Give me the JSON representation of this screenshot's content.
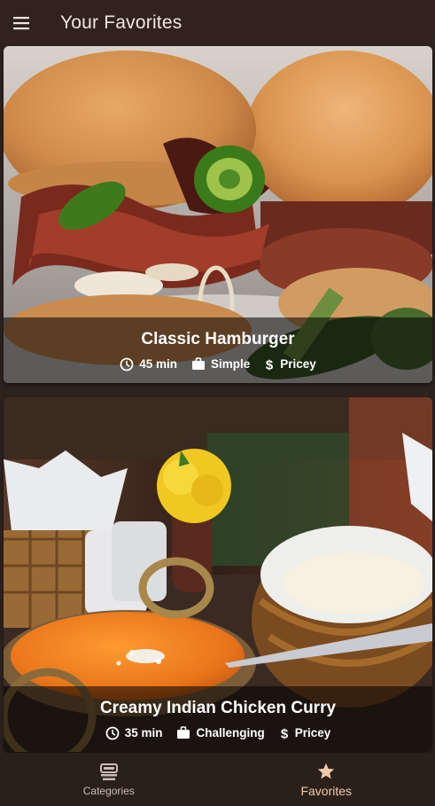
{
  "appbar": {
    "title": "Your Favorites",
    "menu_icon": "menu-icon",
    "background": "#32221d"
  },
  "meals": [
    {
      "title": "Classic Hamburger",
      "duration": "45 min",
      "complexity": "Simple",
      "affordability": "Pricey",
      "image": "hamburger-photo"
    },
    {
      "title": "Creamy Indian Chicken Curry",
      "duration": "35 min",
      "complexity": "Challenging",
      "affordability": "Pricey",
      "image": "chicken-curry-photo"
    }
  ],
  "bottom_nav": {
    "items": [
      {
        "label": "Categories",
        "icon": "categories-icon",
        "active": false
      },
      {
        "label": "Favorites",
        "icon": "star-icon",
        "active": true
      }
    ],
    "active_color": "#f0c9a8",
    "inactive_color": "#c9bdb6"
  }
}
